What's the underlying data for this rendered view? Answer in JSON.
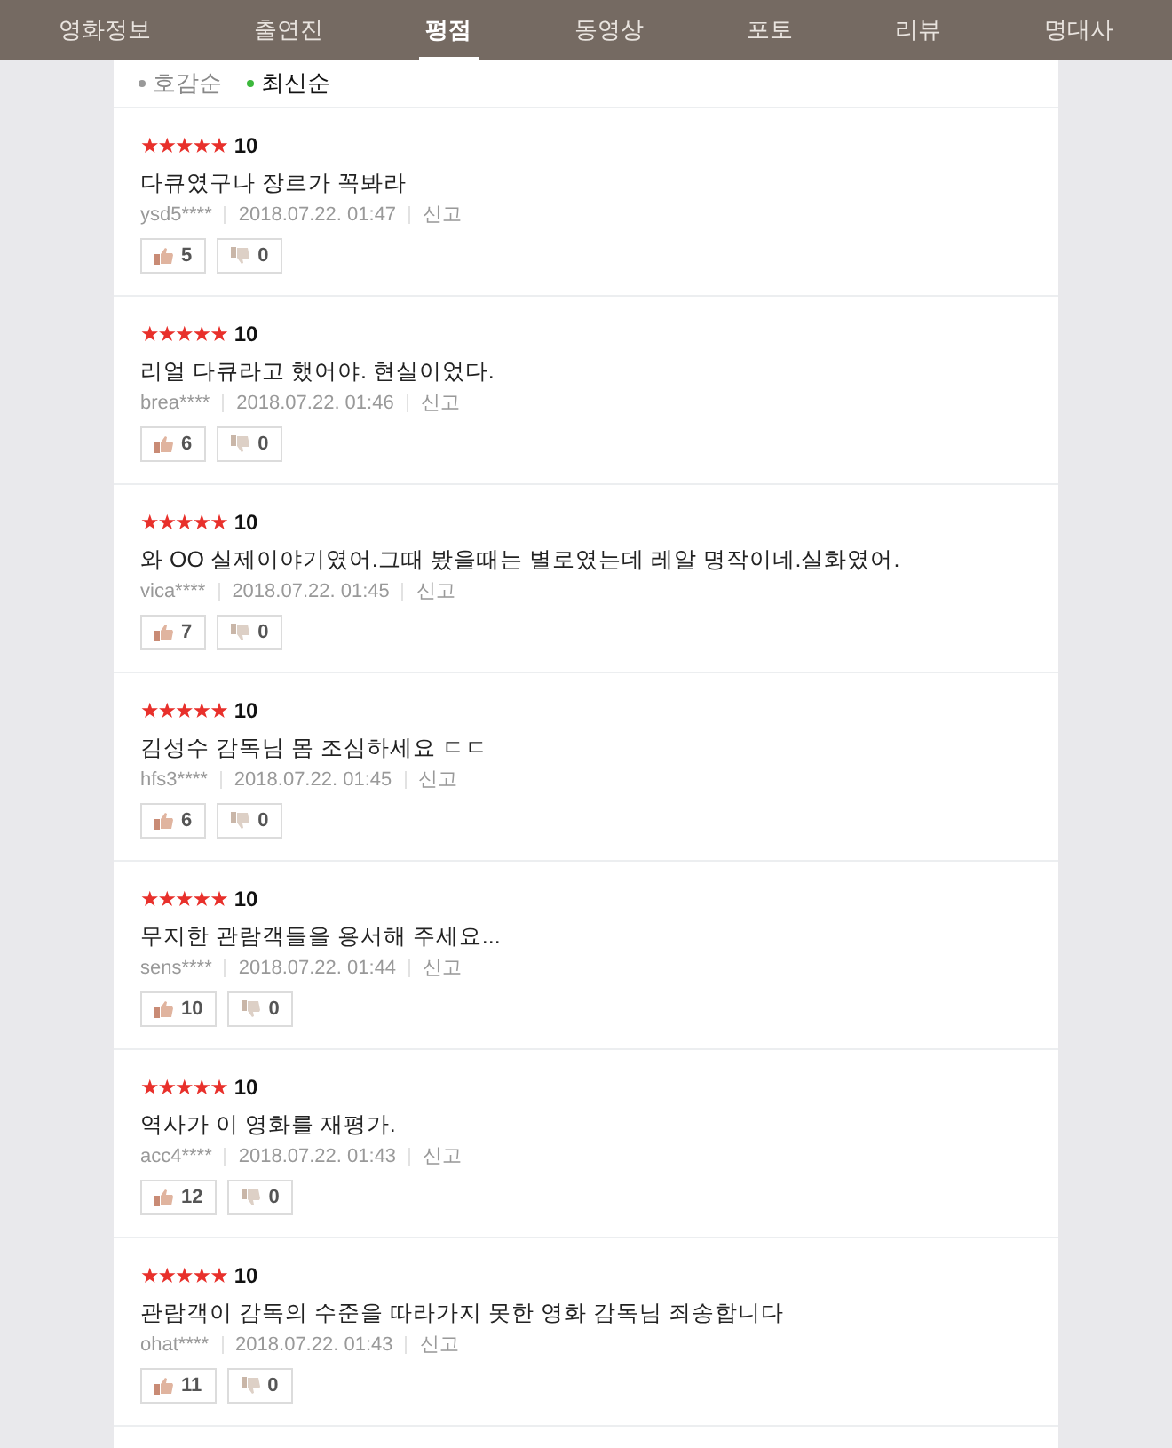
{
  "tabs": [
    {
      "label": "영화정보",
      "selected": false
    },
    {
      "label": "출연진",
      "selected": false
    },
    {
      "label": "평점",
      "selected": true
    },
    {
      "label": "동영상",
      "selected": false
    },
    {
      "label": "포토",
      "selected": false
    },
    {
      "label": "리뷰",
      "selected": false
    },
    {
      "label": "명대사",
      "selected": false
    }
  ],
  "sort_options": [
    {
      "label": "호감순",
      "selected": false
    },
    {
      "label": "최신순",
      "selected": true
    }
  ],
  "reviews": [
    {
      "stars": 5,
      "score": "10",
      "comment": "다큐였구나 장르가 꼭봐라",
      "user": "ysd5****",
      "date": "2018.07.22. 01:47",
      "report": "신고",
      "likes": "5",
      "dislikes": "0"
    },
    {
      "stars": 5,
      "score": "10",
      "comment": "리얼 다큐라고 했어야. 현실이었다.",
      "user": "brea****",
      "date": "2018.07.22. 01:46",
      "report": "신고",
      "likes": "6",
      "dislikes": "0"
    },
    {
      "stars": 5,
      "score": "10",
      "comment": "와 OO 실제이야기였어.그때 봤을때는 별로였는데 레알 명작이네.실화였어.",
      "user": "vica****",
      "date": "2018.07.22. 01:45",
      "report": "신고",
      "likes": "7",
      "dislikes": "0"
    },
    {
      "stars": 5,
      "score": "10",
      "comment": "김성수 감독님 몸 조심하세요 ㄷㄷ",
      "user": "hfs3****",
      "date": "2018.07.22. 01:45",
      "report": "신고",
      "likes": "6",
      "dislikes": "0"
    },
    {
      "stars": 5,
      "score": "10",
      "comment": "무지한 관람객들을 용서해 주세요...",
      "user": "sens****",
      "date": "2018.07.22. 01:44",
      "report": "신고",
      "likes": "10",
      "dislikes": "0"
    },
    {
      "stars": 5,
      "score": "10",
      "comment": "역사가 이 영화를 재평가.",
      "user": "acc4****",
      "date": "2018.07.22. 01:43",
      "report": "신고",
      "likes": "12",
      "dislikes": "0"
    },
    {
      "stars": 5,
      "score": "10",
      "comment": "관람객이 감독의 수준을 따라가지 못한 영화 감독님 죄송합니다",
      "user": "ohat****",
      "date": "2018.07.22. 01:43",
      "report": "신고",
      "likes": "11",
      "dislikes": "0"
    }
  ]
}
